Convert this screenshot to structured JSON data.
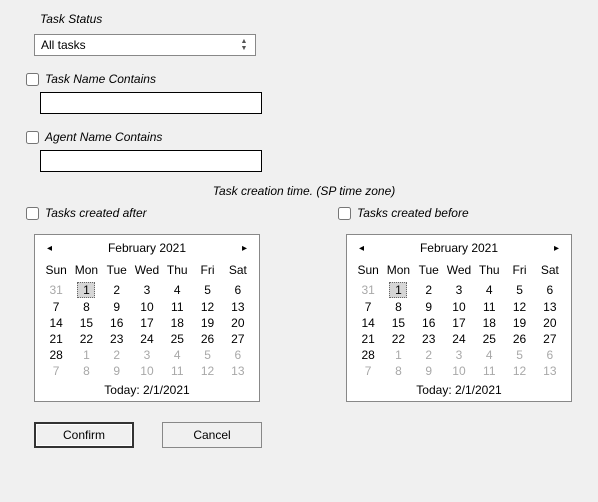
{
  "task_status": {
    "label": "Task Status",
    "selected": "All tasks"
  },
  "task_name": {
    "label": "Task Name Contains",
    "checked": false,
    "value": ""
  },
  "agent_name": {
    "label": "Agent Name Contains",
    "checked": false,
    "value": ""
  },
  "creation_note": "Task creation time. (SP time zone)",
  "created_after": {
    "label": "Tasks created after",
    "checked": false
  },
  "created_before": {
    "label": "Tasks created before",
    "checked": false
  },
  "calendar": {
    "title": "February 2021",
    "today_label": "Today: 2/1/2021",
    "dow": [
      "Sun",
      "Mon",
      "Tue",
      "Wed",
      "Thu",
      "Fri",
      "Sat"
    ],
    "weeks": [
      [
        {
          "d": 31,
          "o": true
        },
        {
          "d": 1,
          "sel": true
        },
        {
          "d": 2
        },
        {
          "d": 3
        },
        {
          "d": 4
        },
        {
          "d": 5
        },
        {
          "d": 6
        }
      ],
      [
        {
          "d": 7
        },
        {
          "d": 8
        },
        {
          "d": 9
        },
        {
          "d": 10
        },
        {
          "d": 11
        },
        {
          "d": 12
        },
        {
          "d": 13
        }
      ],
      [
        {
          "d": 14
        },
        {
          "d": 15
        },
        {
          "d": 16
        },
        {
          "d": 17
        },
        {
          "d": 18
        },
        {
          "d": 19
        },
        {
          "d": 20
        }
      ],
      [
        {
          "d": 21
        },
        {
          "d": 22
        },
        {
          "d": 23
        },
        {
          "d": 24
        },
        {
          "d": 25
        },
        {
          "d": 26
        },
        {
          "d": 27
        }
      ],
      [
        {
          "d": 28
        },
        {
          "d": 1,
          "o": true
        },
        {
          "d": 2,
          "o": true
        },
        {
          "d": 3,
          "o": true
        },
        {
          "d": 4,
          "o": true
        },
        {
          "d": 5,
          "o": true
        },
        {
          "d": 6,
          "o": true
        }
      ],
      [
        {
          "d": 7,
          "o": true
        },
        {
          "d": 8,
          "o": true
        },
        {
          "d": 9,
          "o": true
        },
        {
          "d": 10,
          "o": true
        },
        {
          "d": 11,
          "o": true
        },
        {
          "d": 12,
          "o": true
        },
        {
          "d": 13,
          "o": true
        }
      ]
    ]
  },
  "buttons": {
    "confirm": "Confirm",
    "cancel": "Cancel"
  }
}
